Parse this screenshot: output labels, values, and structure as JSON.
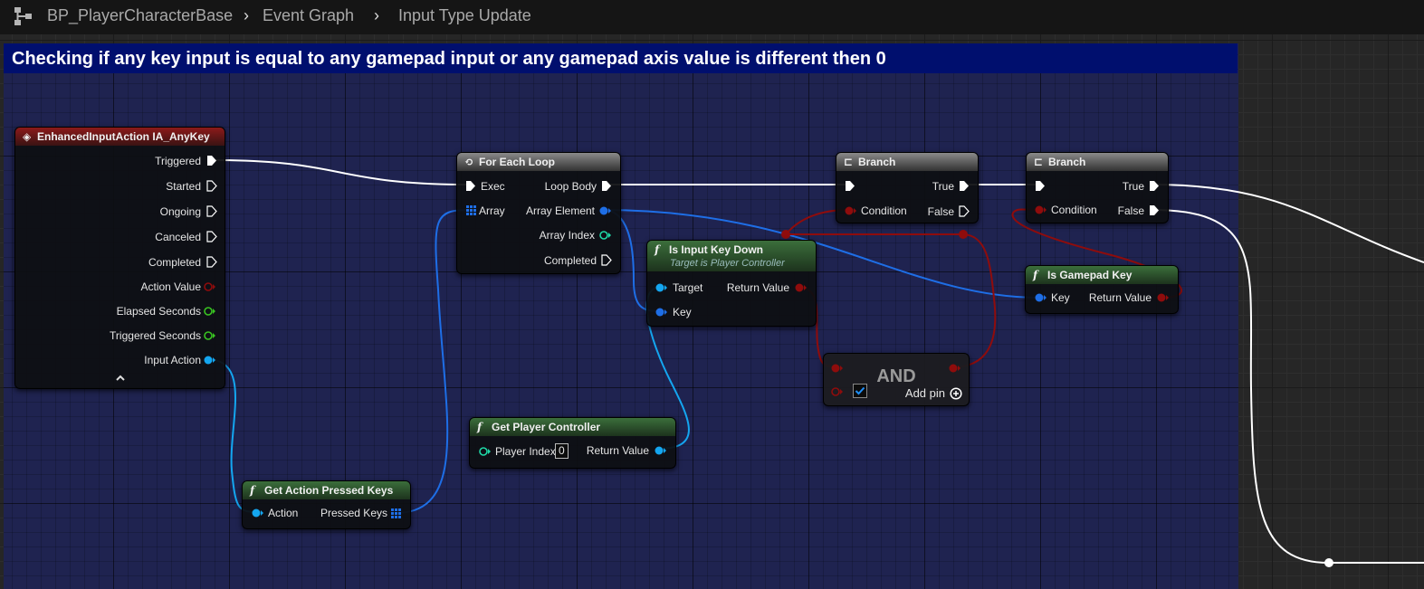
{
  "breadcrumb": {
    "root": "BP_PlayerCharacterBase",
    "graph": "Event Graph",
    "tab": "Input Type Update"
  },
  "comment": {
    "title": "Checking if any key input is equal to any gamepad input or any gamepad axis value is different then 0"
  },
  "colors": {
    "exec": "#ffffff",
    "struct_key": "#1e6ee6",
    "object": "#14a6f0",
    "bool": "#8f0c0c",
    "int": "#1fd9a7",
    "float": "#39c421",
    "comment_bg": "#1f2350",
    "comment_header": "#000f6e"
  },
  "nodes": {
    "input_event": {
      "title": "EnhancedInputAction IA_AnyKey",
      "outputs": [
        "Triggered",
        "Started",
        "Ongoing",
        "Canceled",
        "Completed",
        "Action Value",
        "Elapsed Seconds",
        "Triggered Seconds",
        "Input Action"
      ],
      "collapse_icon": "chevron-up-icon"
    },
    "for_each": {
      "title": "For Each Loop",
      "exec_in": "Exec",
      "array_in": "Array",
      "loop_body": "Loop Body",
      "array_element": "Array Element",
      "array_index": "Array Index",
      "completed": "Completed"
    },
    "branch1": {
      "title": "Branch",
      "condition": "Condition",
      "true_label": "True",
      "false_label": "False"
    },
    "branch2": {
      "title": "Branch",
      "condition": "Condition",
      "true_label": "True",
      "false_label": "False"
    },
    "is_input_key_down": {
      "title": "Is Input Key Down",
      "subtitle": "Target is Player Controller",
      "target": "Target",
      "key": "Key",
      "return_value": "Return Value"
    },
    "is_gamepad_key": {
      "title": "Is Gamepad Key",
      "key": "Key",
      "return_value": "Return Value"
    },
    "and": {
      "title": "AND",
      "add_pin": "Add pin"
    },
    "get_player_controller": {
      "title": "Get Player Controller",
      "player_index": "Player Index",
      "player_index_value": "0",
      "return_value": "Return Value"
    },
    "get_action_pressed_keys": {
      "title": "Get Action Pressed Keys",
      "action": "Action",
      "pressed_keys": "Pressed Keys"
    }
  }
}
